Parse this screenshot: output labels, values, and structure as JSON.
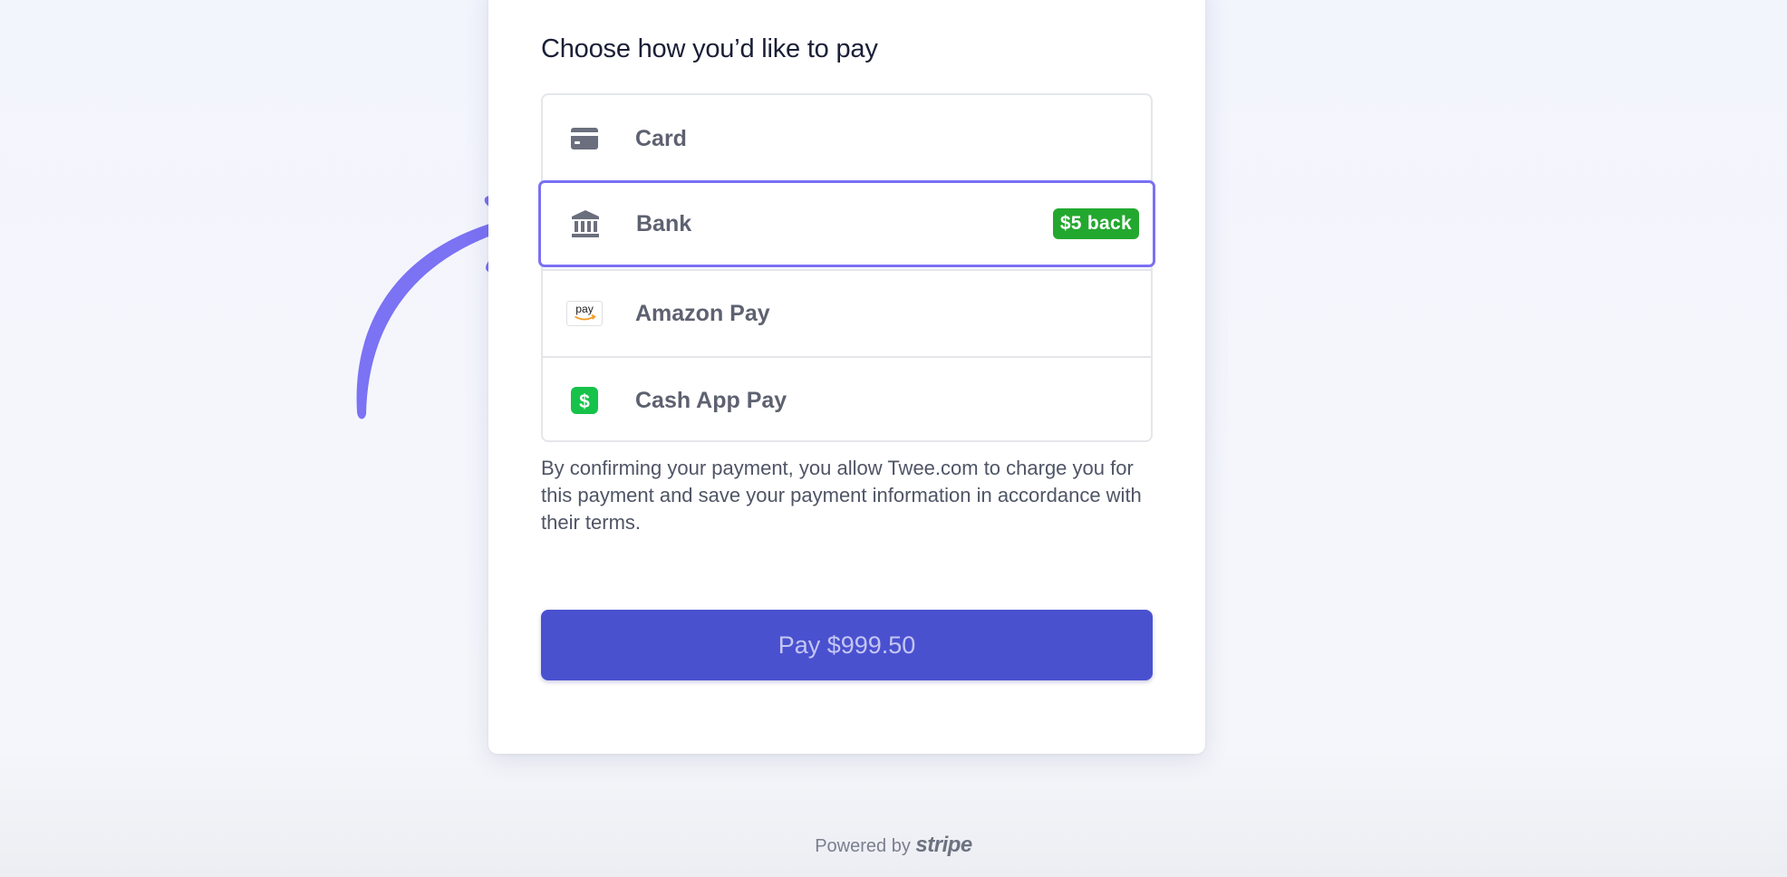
{
  "checkout": {
    "heading": "Choose how you’d like to pay",
    "methods": [
      {
        "label": "Card",
        "icon": "card-icon",
        "selected": false
      },
      {
        "label": "Bank",
        "icon": "bank-icon",
        "selected": true,
        "badge": "$5 back"
      },
      {
        "label": "Amazon Pay",
        "icon": "amazon-pay-icon",
        "icon_text": "pay",
        "selected": false
      },
      {
        "label": "Cash App Pay",
        "icon": "cash-app-icon",
        "icon_text": "$",
        "selected": false
      }
    ],
    "consent_text": "By confirming your payment, you allow Twee.com to charge you for this payment and save your payment information in accordance with their terms.",
    "pay_button": "Pay $999.50"
  },
  "footer": {
    "powered_by": "Powered by",
    "brand": "stripe"
  },
  "colors": {
    "accent": "#7b70f5",
    "pay_button": "#4a51cf",
    "badge": "#23a82f",
    "cash_app": "#16c24a"
  }
}
